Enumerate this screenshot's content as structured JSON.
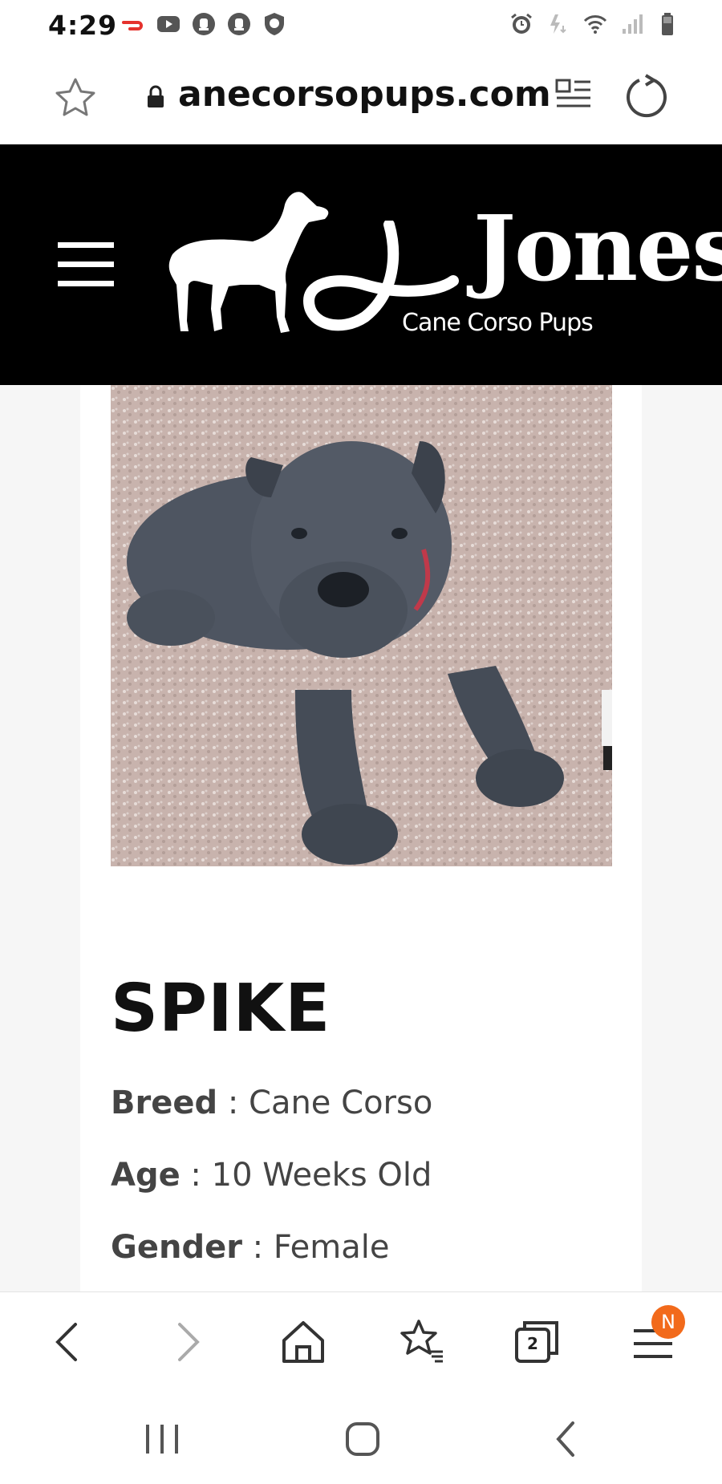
{
  "status_bar": {
    "time": "4:29",
    "left_icons": [
      "doordash-icon",
      "youtube-icon",
      "notification-icon",
      "notification-icon",
      "shield-notification-icon"
    ],
    "right_icons": [
      "alarm-icon",
      "data-saver-icon",
      "wifi-icon",
      "signal-icon",
      "battery-icon"
    ]
  },
  "address_bar": {
    "url": "anecorsopups.com"
  },
  "site_header": {
    "logo_word": "Jones",
    "logo_tagline": "Cane Corso Pups"
  },
  "puppy": {
    "name": "SPIKE",
    "details": [
      {
        "label": "Breed",
        "separator": " : ",
        "value": "Cane Corso"
      },
      {
        "label": "Age",
        "separator": " : ",
        "value": "10 Weeks Old"
      },
      {
        "label": "Gender",
        "separator": " : ",
        "value": "Female"
      }
    ]
  },
  "browser_toolbar": {
    "tab_count": "2",
    "menu_badge": "N"
  },
  "colors": {
    "header_bg": "#000000",
    "badge": "#f26a1b"
  }
}
